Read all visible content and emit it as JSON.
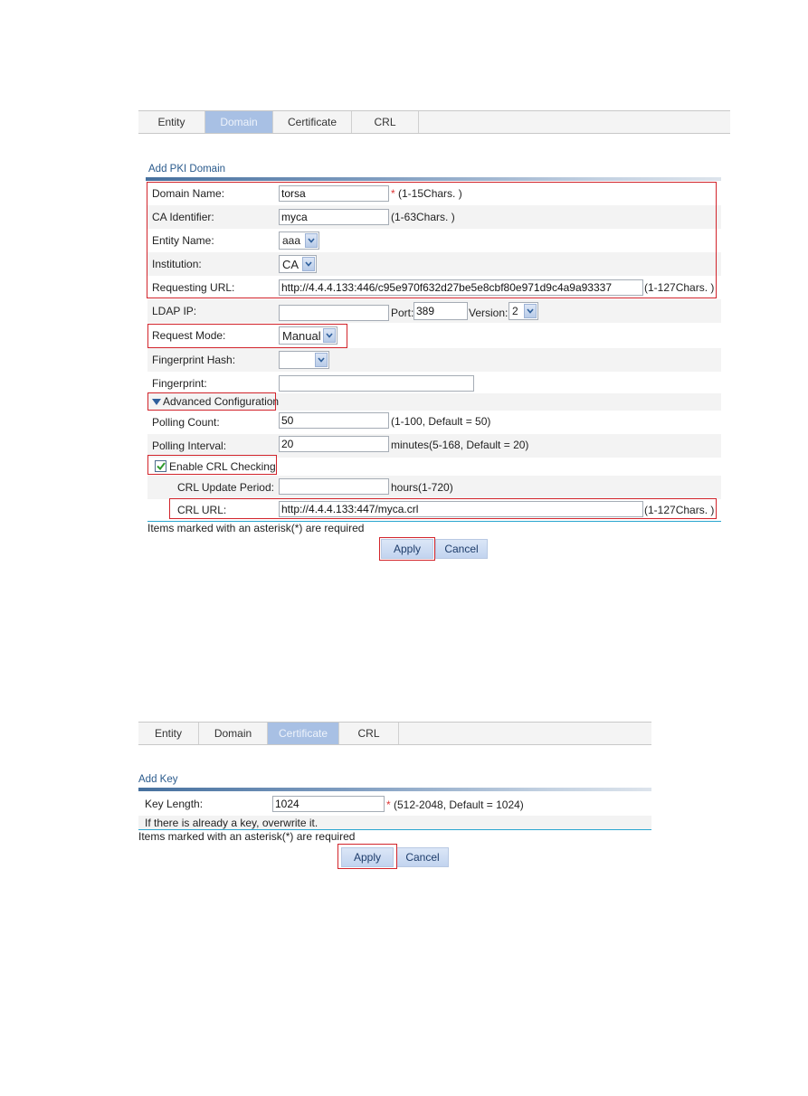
{
  "screen1": {
    "tabs": [
      {
        "label": "Entity",
        "active": false
      },
      {
        "label": "Domain",
        "active": true
      },
      {
        "label": "Certificate",
        "active": false
      },
      {
        "label": "CRL",
        "active": false
      }
    ],
    "section_title": "Add PKI Domain",
    "fields": {
      "domain_name": {
        "label": "Domain Name:",
        "value": "torsa",
        "required_mark": "*",
        "hint": "(1-15Chars. )"
      },
      "ca_identifier": {
        "label": "CA Identifier:",
        "value": "myca",
        "hint": "(1-63Chars. )"
      },
      "entity_name": {
        "label": "Entity Name:",
        "selected": "aaa"
      },
      "institution": {
        "label": "Institution:",
        "selected": "CA"
      },
      "requesting_url": {
        "label": "Requesting URL:",
        "value": "http://4.4.4.133:446/c95e970f632d27be5e8cbf80e971d9c4a9a93337",
        "hint": "(1-127Chars. )"
      },
      "ldap_ip": {
        "label": "LDAP IP:",
        "value": "",
        "port_label": "Port:",
        "port_value": "389",
        "version_label": "Version:",
        "version_selected": "2"
      },
      "request_mode": {
        "label": "Request Mode:",
        "selected": "Manual"
      },
      "fingerprint_hash": {
        "label": "Fingerprint Hash:",
        "selected": ""
      },
      "fingerprint": {
        "label": "Fingerprint:",
        "value": ""
      },
      "advanced_configuration": {
        "label": "Advanced Configuration",
        "expanded": true
      },
      "polling_count": {
        "label": "Polling Count:",
        "value": "50",
        "hint": "(1-100, Default = 50)"
      },
      "polling_interval": {
        "label": "Polling Interval:",
        "value": "20",
        "hint": "minutes(5-168, Default = 20)"
      },
      "enable_crl_checking": {
        "label": "Enable CRL Checking",
        "checked": true
      },
      "crl_update_period": {
        "label": "CRL Update Period:",
        "value": "",
        "hint": "hours(1-720)"
      },
      "crl_url": {
        "label": "CRL URL:",
        "value": "http://4.4.4.133:447/myca.crl",
        "hint": "(1-127Chars. )"
      }
    },
    "required_note": "Items marked with an asterisk(*) are required",
    "apply_label": "Apply",
    "cancel_label": "Cancel"
  },
  "screen2": {
    "tabs": [
      {
        "label": "Entity",
        "active": false
      },
      {
        "label": "Domain",
        "active": false
      },
      {
        "label": "Certificate",
        "active": true
      },
      {
        "label": "CRL",
        "active": false
      }
    ],
    "section_title": "Add Key",
    "fields": {
      "key_length": {
        "label": "Key Length:",
        "value": "1024",
        "required_mark": "*",
        "hint": "(512-2048, Default = 1024)"
      }
    },
    "overwrite_note": "If there is already a key, overwrite it.",
    "required_note": "Items marked with an asterisk(*) are required",
    "apply_label": "Apply",
    "cancel_label": "Cancel"
  },
  "colors": {
    "active_tab": "#a8c0e4",
    "highlight_box": "#d2242b",
    "section_title": "#2a5a8c",
    "footer_line": "#2aa6cf"
  }
}
